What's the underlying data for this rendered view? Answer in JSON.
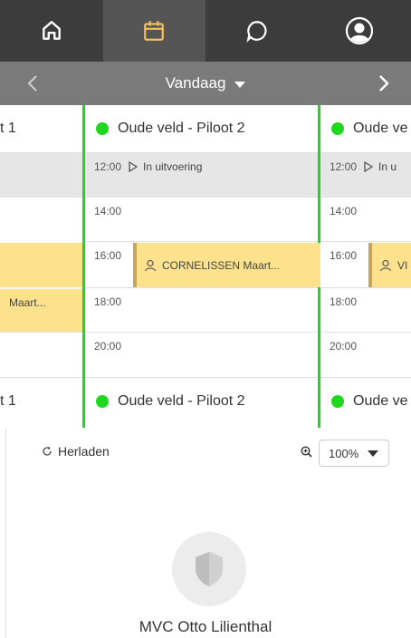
{
  "nav": {
    "tabs": [
      {
        "icon": "home-icon",
        "active": false
      },
      {
        "icon": "calendar-icon",
        "active": true
      },
      {
        "icon": "chat-icon",
        "active": false
      },
      {
        "icon": "account-icon",
        "active": false
      }
    ],
    "accent": "#f5c25a"
  },
  "datebar": {
    "label": "Vandaag"
  },
  "columns": {
    "left": {
      "head": "t 1",
      "booking": "Maart..."
    },
    "mid": {
      "head": "Oude veld - Piloot 2",
      "status": "In uitvoering",
      "booking": "CORNELISSEN Maart..."
    },
    "right": {
      "head": "Oude ve",
      "status": "In u",
      "booking": "VI"
    }
  },
  "times": [
    "12:00",
    "14:00",
    "16:00",
    "18:00",
    "20:00"
  ],
  "colors": {
    "available": "#1ed81e",
    "booking": "#fde28e",
    "booking_edge": "#c8a455",
    "in_progress_bg": "#e6e6e6"
  },
  "controls": {
    "reload_label": "Herladen",
    "zoom_value": "100%"
  },
  "club": {
    "name": "MVC Otto Lilienthal"
  }
}
